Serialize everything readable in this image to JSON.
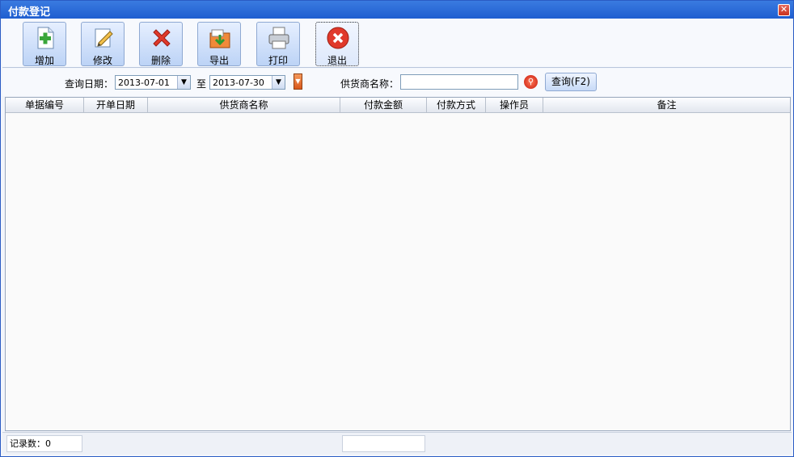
{
  "window": {
    "title": "付款登记",
    "close_symbol": "✕"
  },
  "toolbar": {
    "buttons": [
      {
        "label": "增加",
        "icon": "add-document-icon"
      },
      {
        "label": "修改",
        "icon": "edit-icon"
      },
      {
        "label": "删除",
        "icon": "delete-x-icon"
      },
      {
        "label": "导出",
        "icon": "export-icon"
      },
      {
        "label": "打印",
        "icon": "printer-icon"
      },
      {
        "label": "退出",
        "icon": "exit-icon"
      }
    ]
  },
  "query": {
    "date_label": "查询日期：",
    "date_from": "2013-07-01",
    "to_label": "至",
    "date_to": "2013-07-30",
    "supplier_label": "供货商名称：",
    "supplier_value": "",
    "query_button": "查询(F2)"
  },
  "grid": {
    "columns": [
      "单据编号",
      "开单日期",
      "供货商名称",
      "付款金额",
      "付款方式",
      "操作员",
      "备注"
    ],
    "rows": []
  },
  "status": {
    "record_count_label": "记录数：0"
  }
}
